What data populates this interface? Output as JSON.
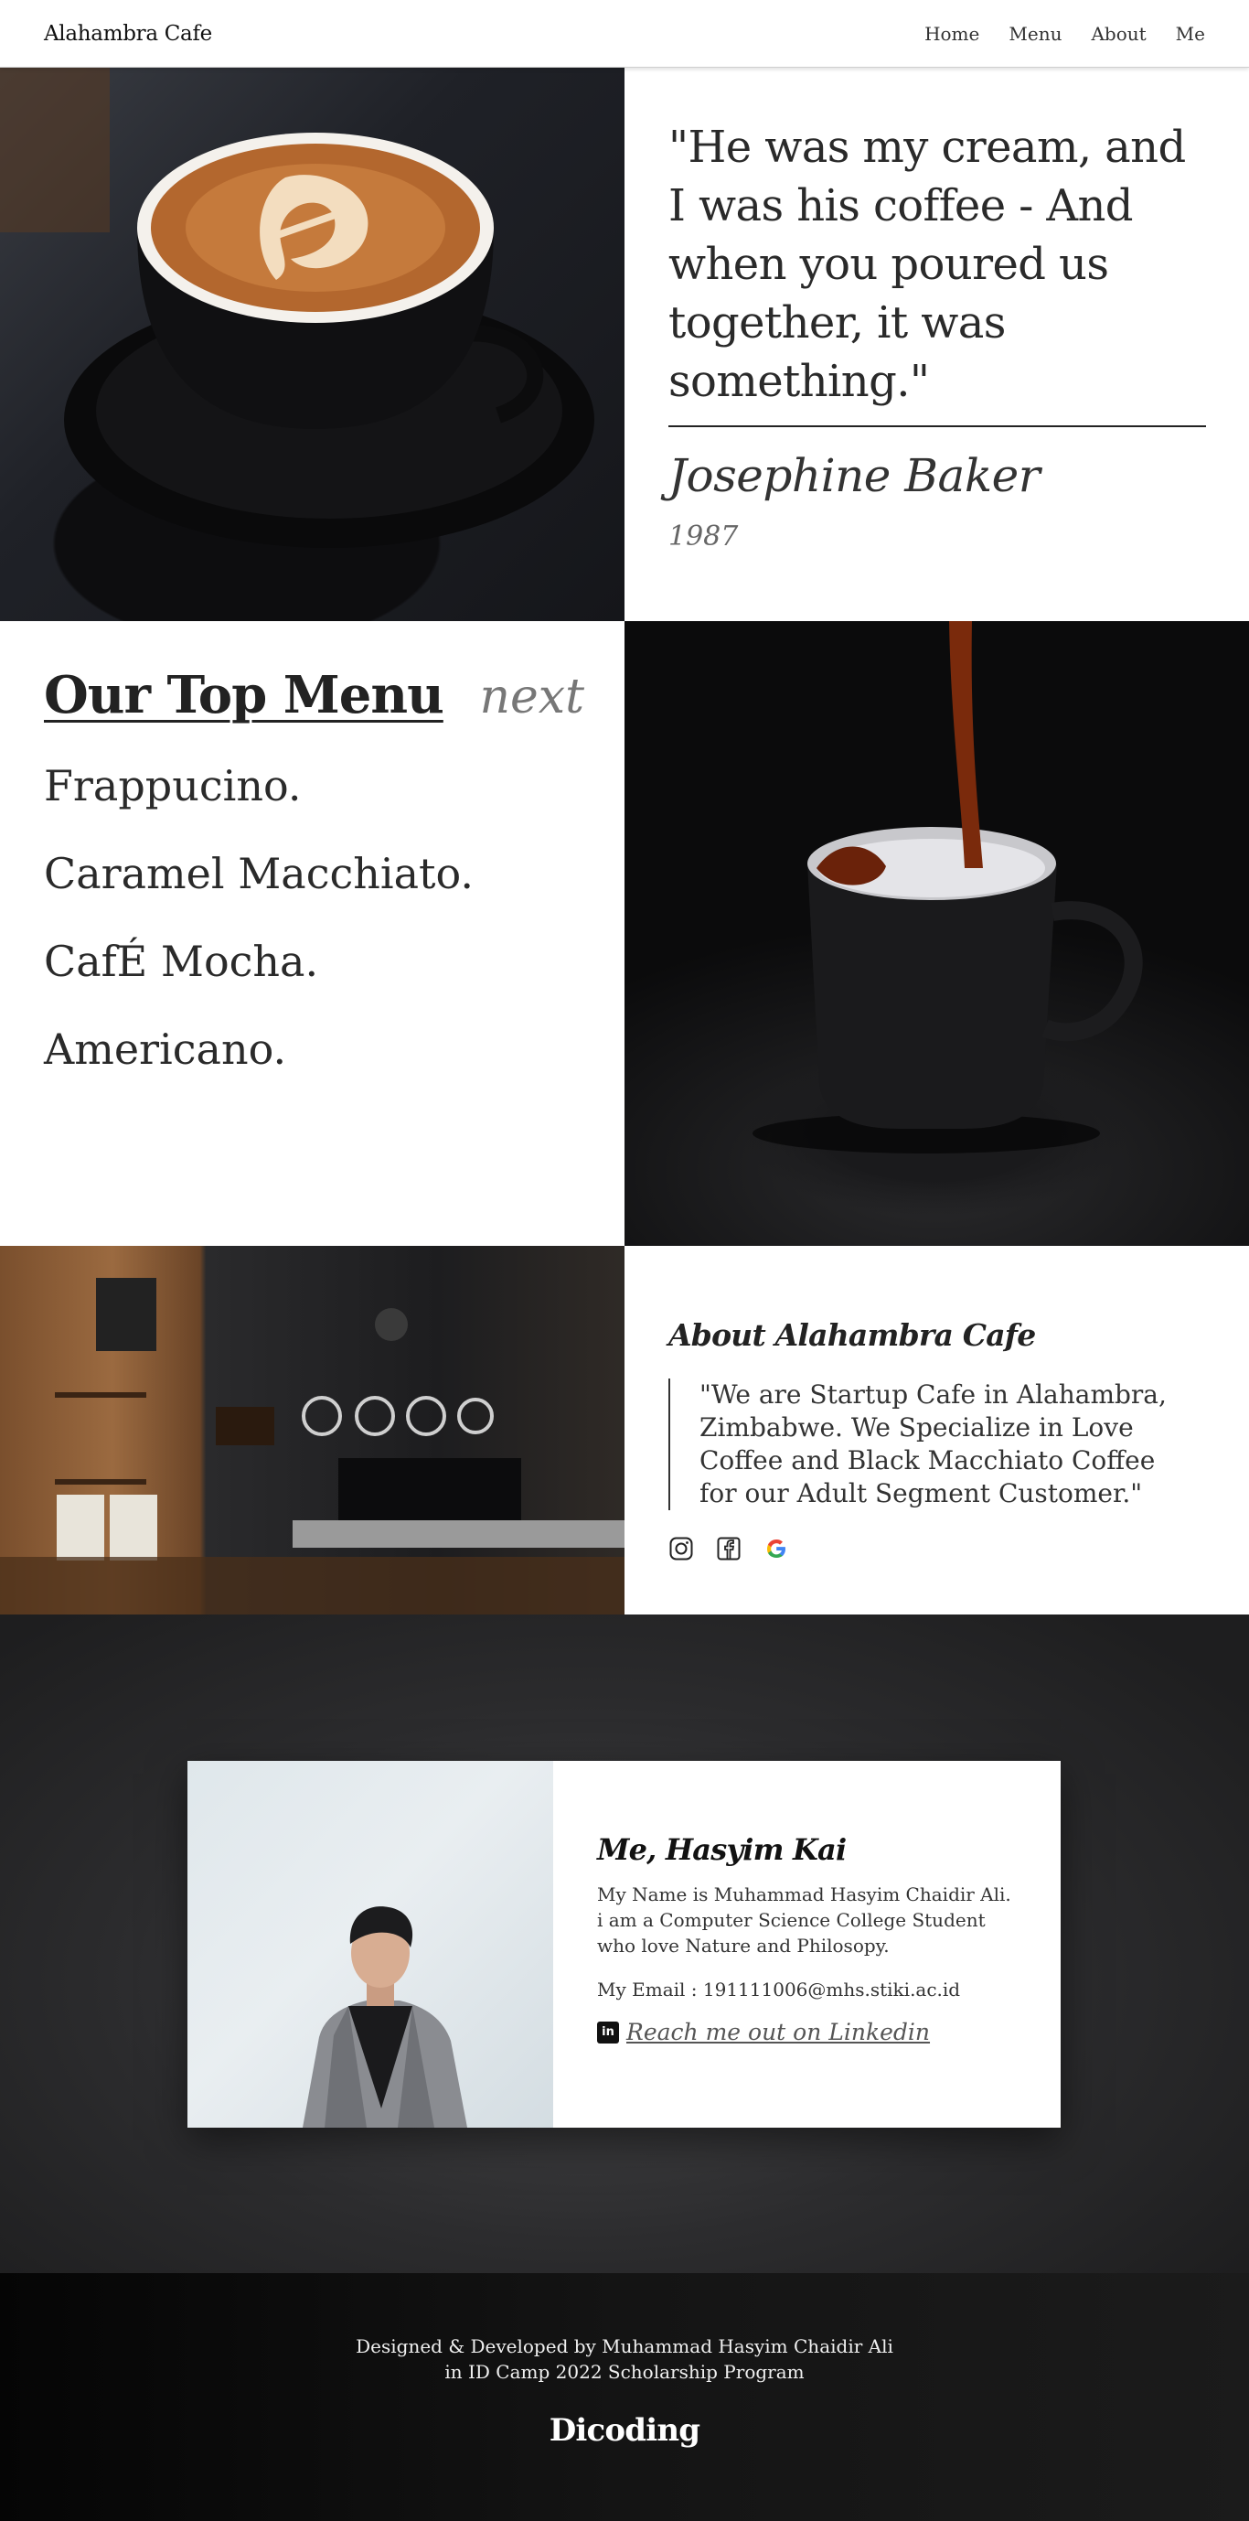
{
  "navbar": {
    "brand": "Alahambra Cafe",
    "links": [
      "Home",
      "Menu",
      "About",
      "Me"
    ]
  },
  "quote": {
    "text": "\"He was my cream, and I was his coffee - And when you poured us together, it was something.\"",
    "author": "Josephine Baker",
    "year": "1987"
  },
  "menu": {
    "title": "Our Top Menu",
    "next": "next",
    "items": [
      "Frappucino.",
      "Caramel Macchiato.",
      "CafÉ Mocha.",
      "Americano."
    ]
  },
  "about": {
    "title": "About Alahambra Cafe",
    "quote": "\"We are Startup Cafe in Alahambra, Zimbabwe. We Specialize in Love Coffee and Black Macchiato Coffee for our Adult Segment Customer.\"",
    "social_icons": [
      "instagram-icon",
      "facebook-icon",
      "google-icon"
    ]
  },
  "profile": {
    "name": "Me, Hasyim Kai",
    "description": "My Name is Muhammad Hasyim Chaidir Ali. i am a Computer Science College Student who love Nature and Philosopy.",
    "email": "My Email : 191111006@mhs.stiki.ac.id",
    "linkedin_badge": "in",
    "linkedin_text": " Reach me out on Linkedin"
  },
  "footer": {
    "line1": "Designed & Developed by Muhammad Hasyim Chaidir Ali",
    "line2": "in ID Camp 2022 Scholarship Program",
    "logo": "Dicoding"
  }
}
